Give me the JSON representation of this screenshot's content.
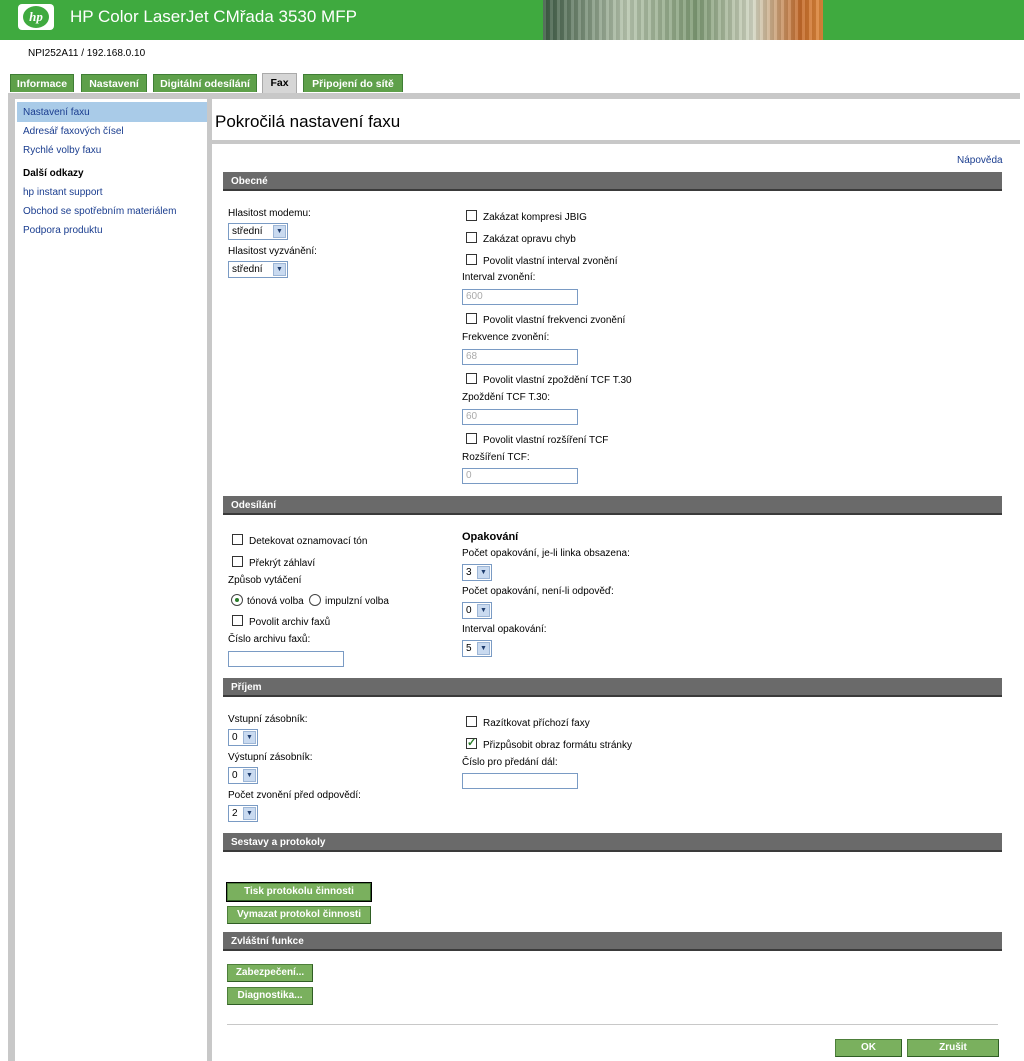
{
  "header": {
    "logo_text": "hp",
    "title": "HP Color LaserJet CMřada 3530 MFP"
  },
  "device": {
    "name": "NPI252A11",
    "separator": "/",
    "ip": "192.168.0.10"
  },
  "tabs": [
    {
      "label": "Informace"
    },
    {
      "label": "Nastavení"
    },
    {
      "label": "Digitální odesílání"
    },
    {
      "label": "Fax",
      "active": true
    },
    {
      "label": "Připojení do sítě"
    }
  ],
  "sidebar": {
    "items": [
      {
        "label": "Nastavení faxu",
        "active": true
      },
      {
        "label": "Adresář faxových čísel"
      },
      {
        "label": "Rychlé volby faxu"
      }
    ],
    "other_heading": "Další odkazy",
    "other_links": [
      {
        "label": "hp instant support"
      },
      {
        "label": "Obchod se spotřebním materiálem"
      },
      {
        "label": "Podpora produktu"
      }
    ]
  },
  "page": {
    "title": "Pokročilá nastavení faxu",
    "help": "Nápověda"
  },
  "general": {
    "title": "Obecné",
    "modem_volume_label": "Hlasitost modemu:",
    "modem_volume_value": "střední",
    "ring_volume_label": "Hlasitost vyzvánění:",
    "ring_volume_value": "střední",
    "disable_jbig": "Zakázat kompresi JBIG",
    "disable_ecm": "Zakázat opravu chyb",
    "custom_ring_interval": "Povolit vlastní interval zvonění",
    "ring_interval_label": "Interval zvonění:",
    "ring_interval_value": "600",
    "custom_ring_freq": "Povolit vlastní frekvenci zvonění",
    "ring_freq_label": "Frekvence zvonění:",
    "ring_freq_value": "68",
    "custom_tcf_delay": "Povolit vlastní zpoždění TCF T.30",
    "tcf_delay_label": "Zpoždění TCF T.30:",
    "tcf_delay_value": "60",
    "custom_tcf_ext": "Povolit vlastní rozšíření TCF",
    "tcf_ext_label": "Rozšíření TCF:",
    "tcf_ext_value": "0"
  },
  "sending": {
    "title": "Odesílání",
    "detect_dial_tone": "Detekovat oznamovací tón",
    "overlay_header": "Překrýt záhlaví",
    "dial_mode_label": "Způsob vytáčení",
    "tone": "tónová volba",
    "pulse": "impulzní volba",
    "enable_archive": "Povolit archiv faxů",
    "archive_number_label": "Číslo archivu faxů:",
    "archive_number_value": "",
    "redial_heading": "Opakování",
    "redial_busy_label": "Počet opakování, je-li linka obsazena:",
    "redial_busy_value": "3",
    "redial_noanswer_label": "Počet opakování, není-li odpověď:",
    "redial_noanswer_value": "0",
    "redial_interval_label": "Interval opakování:",
    "redial_interval_value": "5"
  },
  "receiving": {
    "title": "Příjem",
    "input_tray_label": "Vstupní zásobník:",
    "input_tray_value": "0",
    "output_tray_label": "Výstupní zásobník:",
    "output_tray_value": "0",
    "rings_label": "Počet zvonění před odpovědí:",
    "rings_value": "2",
    "stamp_faxes": "Razítkovat příchozí faxy",
    "fit_to_page": "Přizpůsobit obraz formátu stránky",
    "forward_label": "Číslo pro předání dál:",
    "forward_value": ""
  },
  "reports": {
    "title": "Sestavy a protokoly",
    "print_log": "Tisk protokolu činnosti",
    "clear_log": "Vymazat protokol činnosti"
  },
  "special": {
    "title": "Zvláštní funkce",
    "security": "Zabezpečení...",
    "diagnostics": "Diagnostika..."
  },
  "footer": {
    "ok": "OK",
    "cancel": "Zrušit"
  }
}
